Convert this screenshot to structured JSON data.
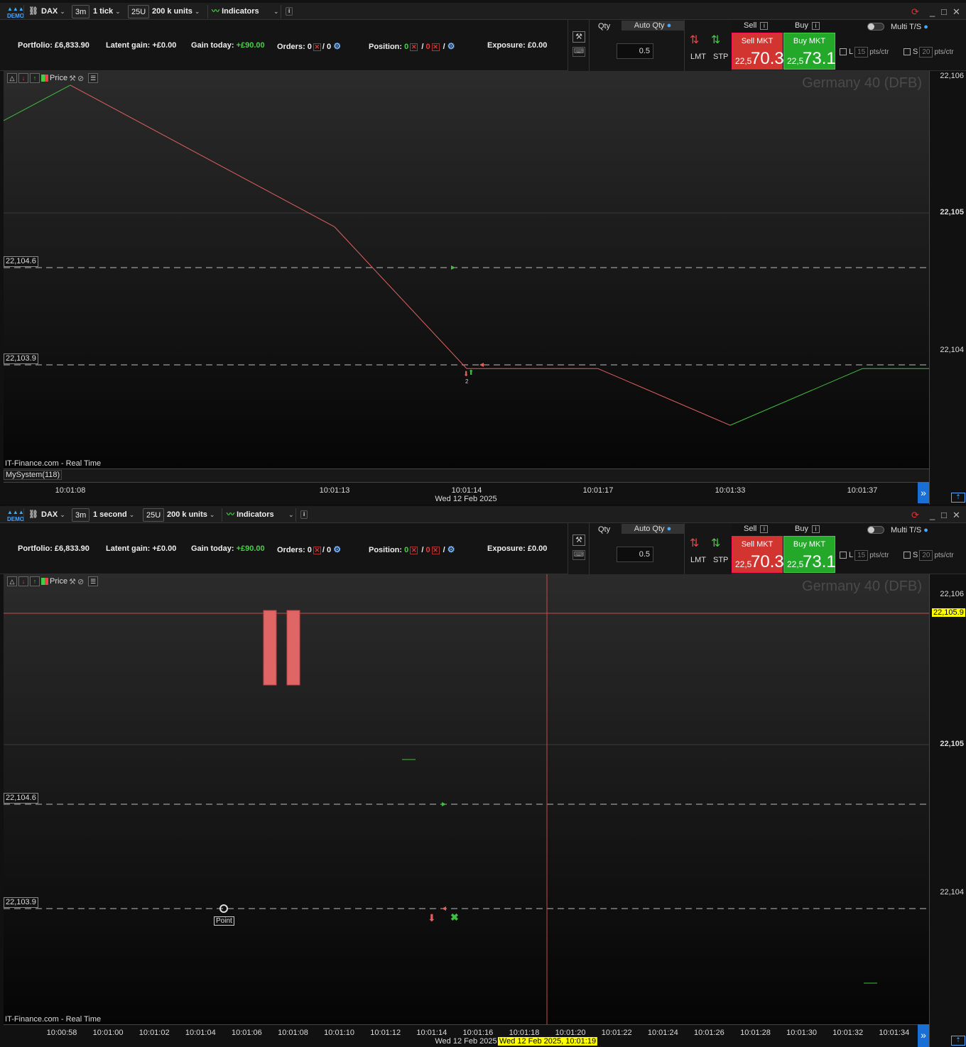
{
  "toolbar_top": {
    "demo": "DEMO",
    "instrument": "DAX",
    "timeframe_box": "3m",
    "interval": "1 tick",
    "units_box": "25U",
    "units": "200 k units",
    "indicators": "Indicators",
    "info": "i"
  },
  "toolbar_bottom": {
    "demo": "DEMO",
    "instrument": "DAX",
    "timeframe_box": "3m",
    "interval": "1 second",
    "units_box": "25U",
    "units": "200 k units",
    "indicators": "Indicators",
    "info": "i"
  },
  "account": {
    "portfolio": "Portfolio: £6,833.90",
    "latent": "Latent gain: +£0.00",
    "gain_label": "Gain today:",
    "gain_value": "+£90.00",
    "orders_label": "Orders: 0",
    "orders_sep": "/ 0",
    "position_label": "Position:",
    "position_a": "0",
    "position_b": "0",
    "slash": "/",
    "exposure": "Exposure: £0.00"
  },
  "order_panel": {
    "qty_label": "Qty",
    "auto_qty": "Auto Qty",
    "qty_value": "0.5",
    "lmt": "LMT",
    "stp": "STP",
    "sell_header": "Sell",
    "buy_header": "Buy",
    "sell_mkt": "Sell MKT",
    "buy_mkt": "Buy MKT",
    "sell_small": "22,5",
    "sell_big": "70.3",
    "buy_small": "22,5",
    "buy_big": "73.1",
    "multi_ts": "Multi T/S",
    "l_label": "L",
    "l_value": "15",
    "s_label": "S",
    "s_value": "20",
    "pts": "pts/ctr"
  },
  "chart_top": {
    "price_label": "Price",
    "watermark": "Germany 40 (DFB)",
    "source": "IT-Finance.com - Real Time",
    "system": "MySystem(118)",
    "level_high": "22,104.6",
    "level_low": "22,103.9",
    "trade_count": "2",
    "y_ticks": [
      "22,106",
      "22,105",
      "22,104"
    ],
    "x_ticks": [
      "10:01:08",
      "10:01:13",
      "10:01:14",
      "10:01:17",
      "10:01:33",
      "10:01:37"
    ],
    "date": "Wed 12 Feb 2025"
  },
  "chart_bottom": {
    "price_label": "Price",
    "watermark": "Germany 40 (DFB)",
    "source": "IT-Finance.com - Real Time",
    "level_high": "22,104.6",
    "level_low": "22,103.9",
    "point_label": "Point",
    "cursor_price": "22,105.9",
    "cursor_time": "Wed 12 Feb 2025, 10:01:19",
    "y_ticks": [
      "22,106",
      "22,105",
      "22,104"
    ],
    "x_ticks": [
      "10:00:58",
      "10:01:00",
      "10:01:02",
      "10:01:04",
      "10:01:06",
      "10:01:08",
      "10:01:10",
      "10:01:12",
      "10:01:14",
      "10:01:16",
      "10:01:18",
      "10:01:20",
      "10:01:22",
      "10:01:24",
      "10:01:26",
      "10:01:28",
      "10:01:30",
      "10:01:32",
      "10:01:34"
    ],
    "date": "Wed 12 Feb 2025"
  },
  "chart_data": [
    {
      "type": "line",
      "title": "Germany 40 (DFB)",
      "x": [
        "10:01:08",
        "10:01:13",
        "10:01:14",
        "10:01:17",
        "10:01:33",
        "10:01:37"
      ],
      "y": [
        22105.9,
        22104.9,
        22103.9,
        22103.9,
        22103.5,
        22103.9
      ],
      "ylim": [
        22103.1,
        22106.0
      ]
    },
    {
      "type": "bar",
      "title": "Germany 40 (DFB)",
      "x_range": [
        "10:00:58",
        "10:01:34"
      ],
      "ylim": [
        22103.0,
        22106.1
      ]
    }
  ],
  "colors": {
    "up": "#3fbf3f",
    "down": "#e0605f",
    "sell": "#d2342f",
    "buy": "#23a82a",
    "cursor_tag": "#ffff00"
  }
}
